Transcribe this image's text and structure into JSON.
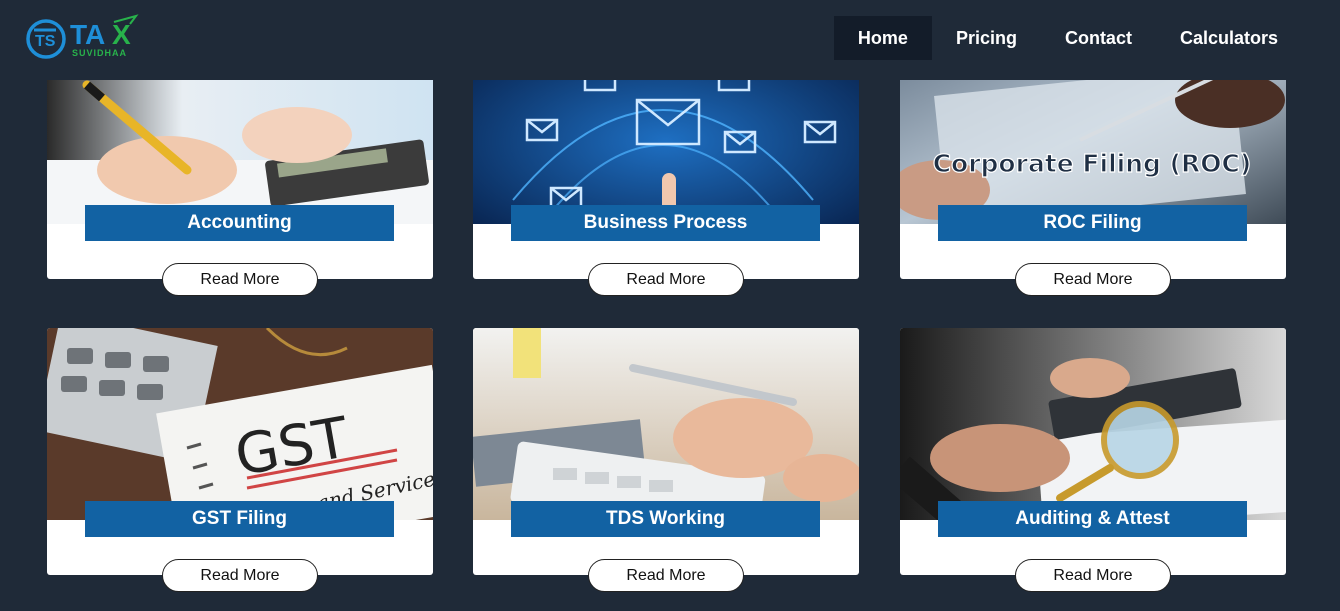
{
  "brand": {
    "logo_mark": "TS",
    "logo_word": "TAX",
    "logo_sub": "SUVIDHAA"
  },
  "nav": {
    "items": [
      {
        "label": "Home",
        "active": true
      },
      {
        "label": "Pricing",
        "active": false
      },
      {
        "label": "Contact",
        "active": false
      },
      {
        "label": "Calculators",
        "active": false
      }
    ]
  },
  "services": [
    {
      "title": "Accounting",
      "button": "Read More",
      "image": "hand-calculator-photo"
    },
    {
      "title": "Business Process",
      "button": "Read More",
      "image": "email-network-photo"
    },
    {
      "title": "ROC Filing",
      "button": "Read More",
      "image": "corporate-filing-photo",
      "image_text": "Corporate Filing (ROC)"
    },
    {
      "title": "GST Filing",
      "button": "Read More",
      "image": "gst-notebook-photo",
      "image_text": "GST",
      "image_subtext": "and Services"
    },
    {
      "title": "TDS Working",
      "button": "Read More",
      "image": "pen-calculator-photo"
    },
    {
      "title": "Auditing & Attest",
      "button": "Read More",
      "image": "magnifier-calculator-photo"
    }
  ],
  "colors": {
    "background": "#1f2a38",
    "nav_active": "#131c29",
    "label_bg": "#1262a3",
    "logo_blue": "#1e8fd8",
    "logo_green": "#28b24b"
  }
}
